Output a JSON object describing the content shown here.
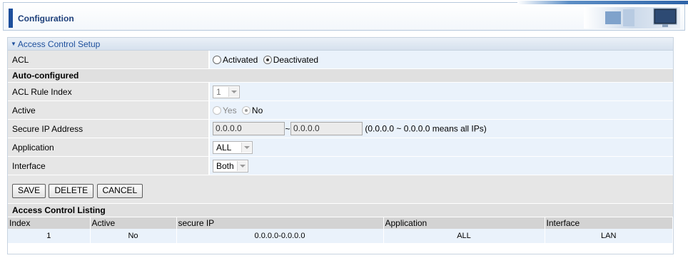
{
  "header": {
    "title": "Configuration"
  },
  "panel": {
    "title": "Access Control Setup"
  },
  "acl": {
    "label": "ACL",
    "options": [
      "Activated",
      "Deactivated"
    ],
    "selected": "Deactivated"
  },
  "auto_configured": {
    "heading": "Auto-configured"
  },
  "rule_index": {
    "label": "ACL Rule Index",
    "value": "1"
  },
  "active": {
    "label": "Active",
    "options": [
      "Yes",
      "No"
    ],
    "selected": "No"
  },
  "secure_ip": {
    "label": "Secure IP Address",
    "start": "0.0.0.0",
    "separator": "~",
    "end": "0.0.0.0",
    "hint": "(0.0.0.0 ~ 0.0.0.0 means all IPs)"
  },
  "application": {
    "label": "Application",
    "value": "ALL"
  },
  "interface": {
    "label": "Interface",
    "value": "Both"
  },
  "buttons": {
    "save": "SAVE",
    "delete": "DELETE",
    "cancel": "CANCEL"
  },
  "listing": {
    "heading": "Access Control Listing",
    "columns": [
      "Index",
      "Active",
      "secure IP",
      "Application",
      "Interface"
    ],
    "rows": [
      [
        "1",
        "No",
        "0.0.0.0-0.0.0.0",
        "ALL",
        "LAN"
      ]
    ]
  },
  "colors": {
    "accent": "#1d4f9c",
    "value_bg": "#eaf2fb",
    "label_bg": "#e6e6e6"
  }
}
